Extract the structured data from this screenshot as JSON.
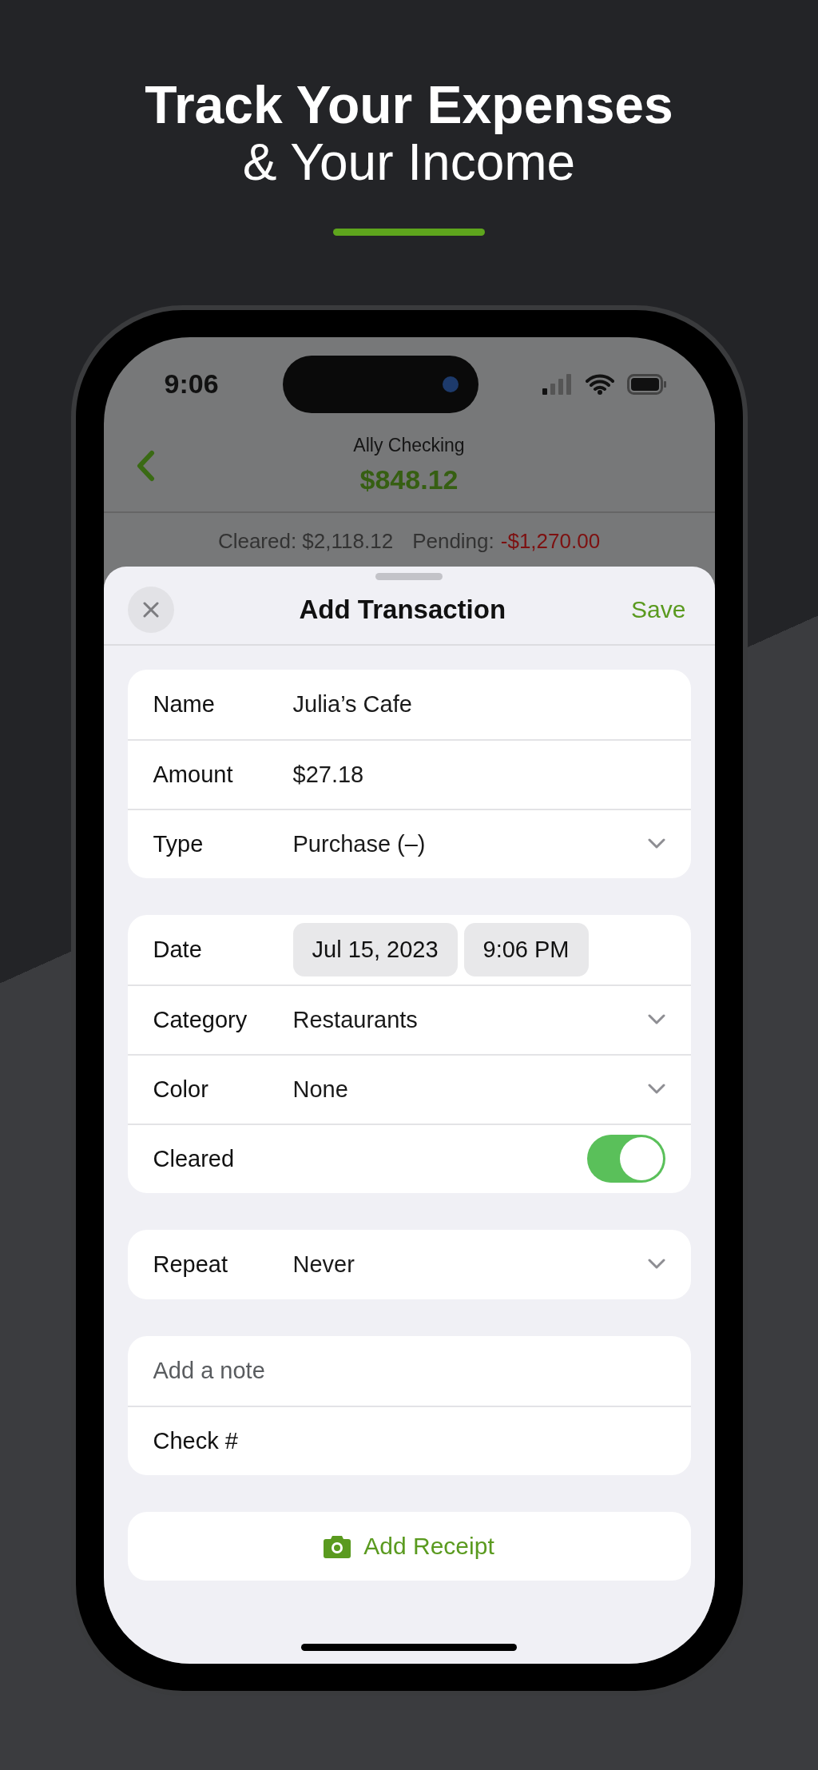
{
  "headline": {
    "title": "Track Your Expenses",
    "subtitle": "& Your Income"
  },
  "status_bar": {
    "time": "9:06"
  },
  "account": {
    "name": "Ally Checking",
    "balance": "$848.12",
    "cleared_label": "Cleared:",
    "cleared": "$2,118.12",
    "pending_label": "Pending:",
    "pending": "-$1,270.00"
  },
  "sheet": {
    "title": "Add Transaction",
    "save": "Save"
  },
  "sections": [
    {
      "rows": [
        {
          "kind": "text",
          "label": "Name",
          "value": "Julia’s Cafe"
        },
        {
          "kind": "text",
          "label": "Amount",
          "value": "$27.18"
        },
        {
          "kind": "select",
          "label": "Type",
          "value": "Purchase (–)"
        }
      ]
    },
    {
      "rows": [
        {
          "kind": "datetime",
          "label": "Date",
          "date": "Jul 15, 2023",
          "time": "9:06 PM"
        },
        {
          "kind": "select",
          "label": "Category",
          "value": "Restaurants"
        },
        {
          "kind": "select",
          "label": "Color",
          "value": "None"
        },
        {
          "kind": "toggle",
          "label": "Cleared",
          "on": true
        }
      ]
    },
    {
      "rows": [
        {
          "kind": "select",
          "label": "Repeat",
          "value": "Never"
        }
      ]
    },
    {
      "rows": [
        {
          "kind": "note",
          "placeholder": "Add a note"
        },
        {
          "kind": "plain",
          "label": "Check #"
        }
      ]
    }
  ],
  "receipt_button": "Add Receipt"
}
